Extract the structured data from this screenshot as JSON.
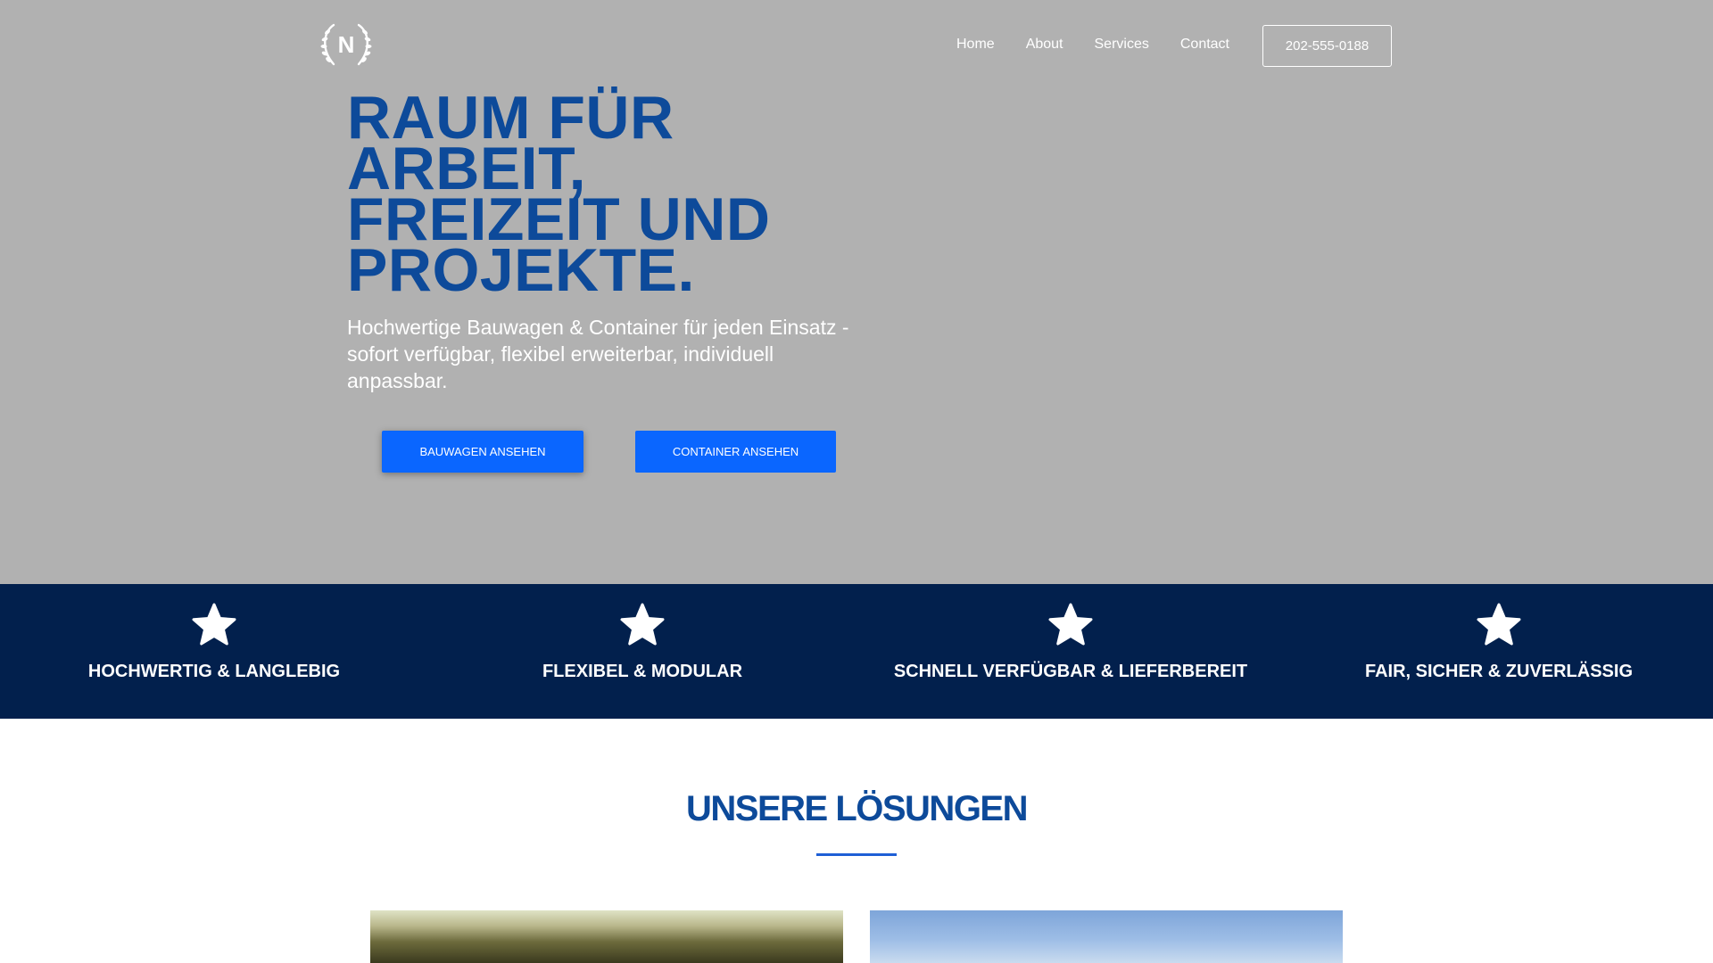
{
  "header": {
    "logo_letter": "N",
    "nav": [
      "Home",
      "About",
      "Services",
      "Contact"
    ],
    "phone": "202-555-0188"
  },
  "hero": {
    "headline_lines": [
      "RAUM FÜR",
      "ARBEIT,",
      "FREIZEIT UND",
      "PROJEKTE."
    ],
    "subline": "Hochwertige Bauwagen & Container für jeden Einsatz - sofort verfügbar, flexibel erweiterbar, individuell anpassbar.",
    "cta_primary": "BAUWAGEN ANSEHEN",
    "cta_secondary": "CONTAINER ANSEHEN"
  },
  "features": [
    {
      "label": "HOCHWERTIG & LANGLEBIG",
      "icon": "star-icon"
    },
    {
      "label": "FLEXIBEL & MODULAR",
      "icon": "star-icon"
    },
    {
      "label": "SCHNELL VERFÜGBAR & LIEFERBEREIT",
      "icon": "star-icon"
    },
    {
      "label": "FAIR, SICHER & ZUVERLÄSSIG",
      "icon": "star-icon"
    }
  ],
  "solutions": {
    "title": "UNSERE LÖSUNGEN"
  },
  "colors": {
    "hero_bg": "#b1b1b1",
    "headline": "#0d4a9a",
    "button_blue": "#0a66ff",
    "feature_bar": "#02204d"
  }
}
